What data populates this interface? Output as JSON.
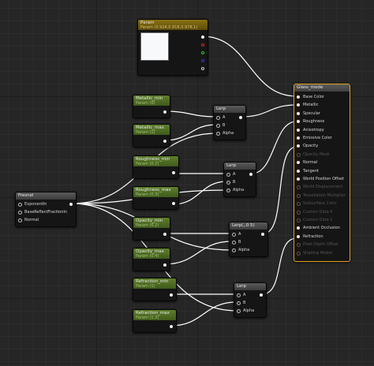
{
  "nodes": {
    "param": {
      "title": "Param",
      "subtitle": "Param (0.924,0.918,0.978,1)"
    },
    "metallic_min": {
      "title": "Metallic_min",
      "subtitle": "Param (0)"
    },
    "metallic_max": {
      "title": "Metallic_max",
      "subtitle": "Param (1)"
    },
    "roughness_min": {
      "title": "Roughness_min",
      "subtitle": "Param (0.2)"
    },
    "roughness_max": {
      "title": "Roughness_max",
      "subtitle": "Param (0.3)"
    },
    "opacity_min": {
      "title": "Opacity_min",
      "subtitle": "Param (0.2)"
    },
    "opacity_max": {
      "title": "Opacity_max",
      "subtitle": "Param (0.4)"
    },
    "refraction_min": {
      "title": "Refraction_min",
      "subtitle": "Param (1)"
    },
    "refraction_max": {
      "title": "Refraction_max",
      "subtitle": "Param (1.3)"
    },
    "fresnel": {
      "title": "Fresnel",
      "pins": [
        "ExponentIn",
        "BaseReflectFractionIn",
        "Normal"
      ]
    },
    "lerp1": {
      "title": "Lerp",
      "pins": [
        "A",
        "B",
        "Alpha"
      ]
    },
    "lerp2": {
      "title": "Lerp",
      "pins": [
        "A",
        "B",
        "Alpha"
      ]
    },
    "lerp3": {
      "title": "Lerp(,,0.5)",
      "pins": [
        "A",
        "B",
        "Alpha"
      ]
    },
    "lerp4": {
      "title": "Lerp",
      "pins": [
        "A",
        "B",
        "Alpha"
      ]
    },
    "main": {
      "title": "Glass_mode",
      "pins": [
        {
          "label": "Base Color",
          "active": true
        },
        {
          "label": "Metallic",
          "active": true
        },
        {
          "label": "Specular",
          "active": true
        },
        {
          "label": "Roughness",
          "active": true
        },
        {
          "label": "Anisotropy",
          "active": true
        },
        {
          "label": "Emissive Color",
          "active": true
        },
        {
          "label": "Opacity",
          "active": true
        },
        {
          "label": "Opacity Mask",
          "active": false
        },
        {
          "label": "Normal",
          "active": true
        },
        {
          "label": "Tangent",
          "active": true
        },
        {
          "label": "World Position Offset",
          "active": true
        },
        {
          "label": "World Displacement",
          "active": false
        },
        {
          "label": "Tessellation Multiplier",
          "active": false
        },
        {
          "label": "Subsurface Color",
          "active": false
        },
        {
          "label": "Custom Data 0",
          "active": false
        },
        {
          "label": "Custom Data 1",
          "active": false
        },
        {
          "label": "Ambient Occlusion",
          "active": true
        },
        {
          "label": "Refraction",
          "active": true
        },
        {
          "label": "Pixel Depth Offset",
          "active": false
        },
        {
          "label": "Shading Model",
          "active": false
        }
      ]
    }
  },
  "colors": {
    "grid_bg": "#262626",
    "param_header": "#8a7212",
    "scalar_header": "#4f6e24",
    "selection_outline": "#e0a020",
    "wire": "#ffffff",
    "param_swatch": "#f8f9fb"
  },
  "icons": [
    "output-pin-icon",
    "input-pin-icon",
    "red-channel-pin-icon",
    "green-channel-pin-icon",
    "blue-channel-pin-icon",
    "alpha-channel-pin-icon"
  ]
}
